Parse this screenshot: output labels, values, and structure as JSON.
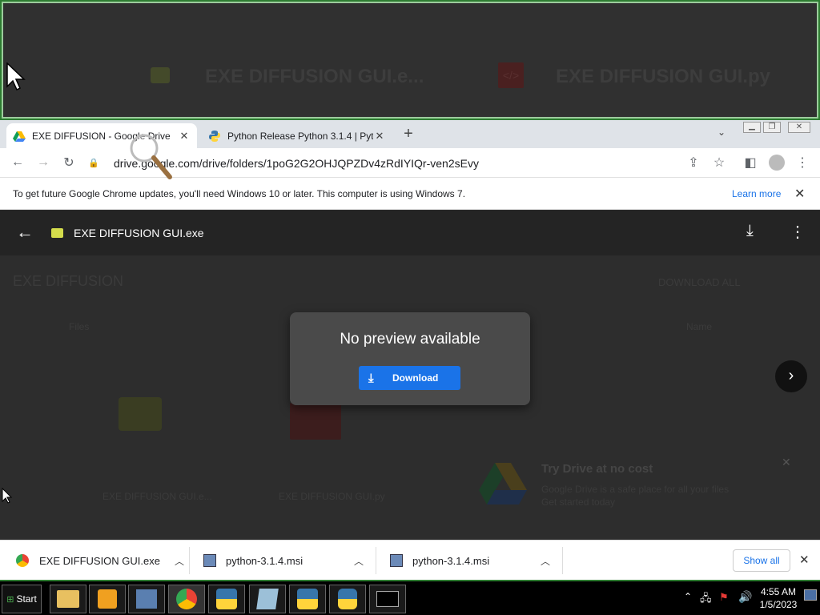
{
  "zoom": {
    "file1": "EXE DIFFUSION GUI.e...",
    "file2": "EXE DIFFUSION GUI.py"
  },
  "tabs": [
    {
      "title": "EXE DIFFUSION - Google Drive",
      "icon": "google-drive-icon"
    },
    {
      "title": "Python Release Python 3.1.4 | Pyth",
      "icon": "python-icon"
    }
  ],
  "address": {
    "url": "drive.google.com/drive/folders/1poG2G2OHJQPZDv4zRdIYIQr-ven2sEvy"
  },
  "infobar": {
    "message": "To get future Google Chrome updates, you'll need Windows 10 or later. This computer is using Windows 7.",
    "learn_more": "Learn more"
  },
  "viewer": {
    "filename": "EXE DIFFUSION GUI.exe",
    "folder_title": "EXE DIFFUSION",
    "download_all": "DOWNLOAD ALL",
    "files_label": "Files",
    "name_label": "Name",
    "file_a": "EXE DIFFUSION GUI.e...",
    "file_b": "EXE DIFFUSION GUI.py",
    "promo_title": "Try Drive at no cost",
    "promo_line1": "Google Drive is a safe place for all your files",
    "promo_line2": "Get started today",
    "no_preview": "No preview available",
    "download_btn": "Download"
  },
  "downloads": {
    "items": [
      {
        "name": "EXE DIFFUSION GUI.exe"
      },
      {
        "name": "python-3.1.4.msi"
      },
      {
        "name": "python-3.1.4.msi"
      }
    ],
    "show_all": "Show all"
  },
  "taskbar": {
    "start": "Start",
    "time": "4:55 AM",
    "date": "1/5/2023"
  },
  "colors": {
    "accent": "#1a73e8",
    "taskbar_border": "#2e7d32"
  }
}
